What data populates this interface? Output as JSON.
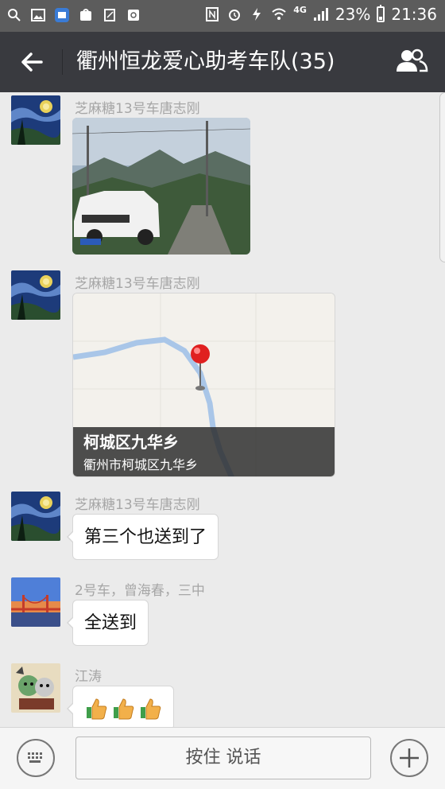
{
  "status_bar": {
    "battery": "23%",
    "time": "21:36",
    "network": "4G",
    "battery_level": 0.23
  },
  "header": {
    "title": "衢州恒龙爱心助考车队(35)"
  },
  "messages": [
    {
      "sender": "芝麻糖13号车唐志刚",
      "type": "image"
    },
    {
      "sender": "芝麻糖13号车唐志刚",
      "type": "location",
      "location_title": "柯城区九华乡",
      "location_address": "衢州市柯城区九华乡"
    },
    {
      "sender": "芝麻糖13号车唐志刚",
      "type": "text",
      "text": "第三个也送到了"
    },
    {
      "sender": "2号车，曾海春，三中",
      "type": "text",
      "text": "全送到"
    },
    {
      "sender": "江涛",
      "type": "emoji",
      "emojis": [
        "thumbs-up",
        "thumbs-up",
        "thumbs-up"
      ]
    }
  ],
  "input_bar": {
    "talk_button": "按住 说话"
  },
  "colors": {
    "header_bg": "#393a3f",
    "status_bg": "#5c5c5c",
    "chat_bg": "#ebebeb",
    "map_pin": "#e02020"
  }
}
